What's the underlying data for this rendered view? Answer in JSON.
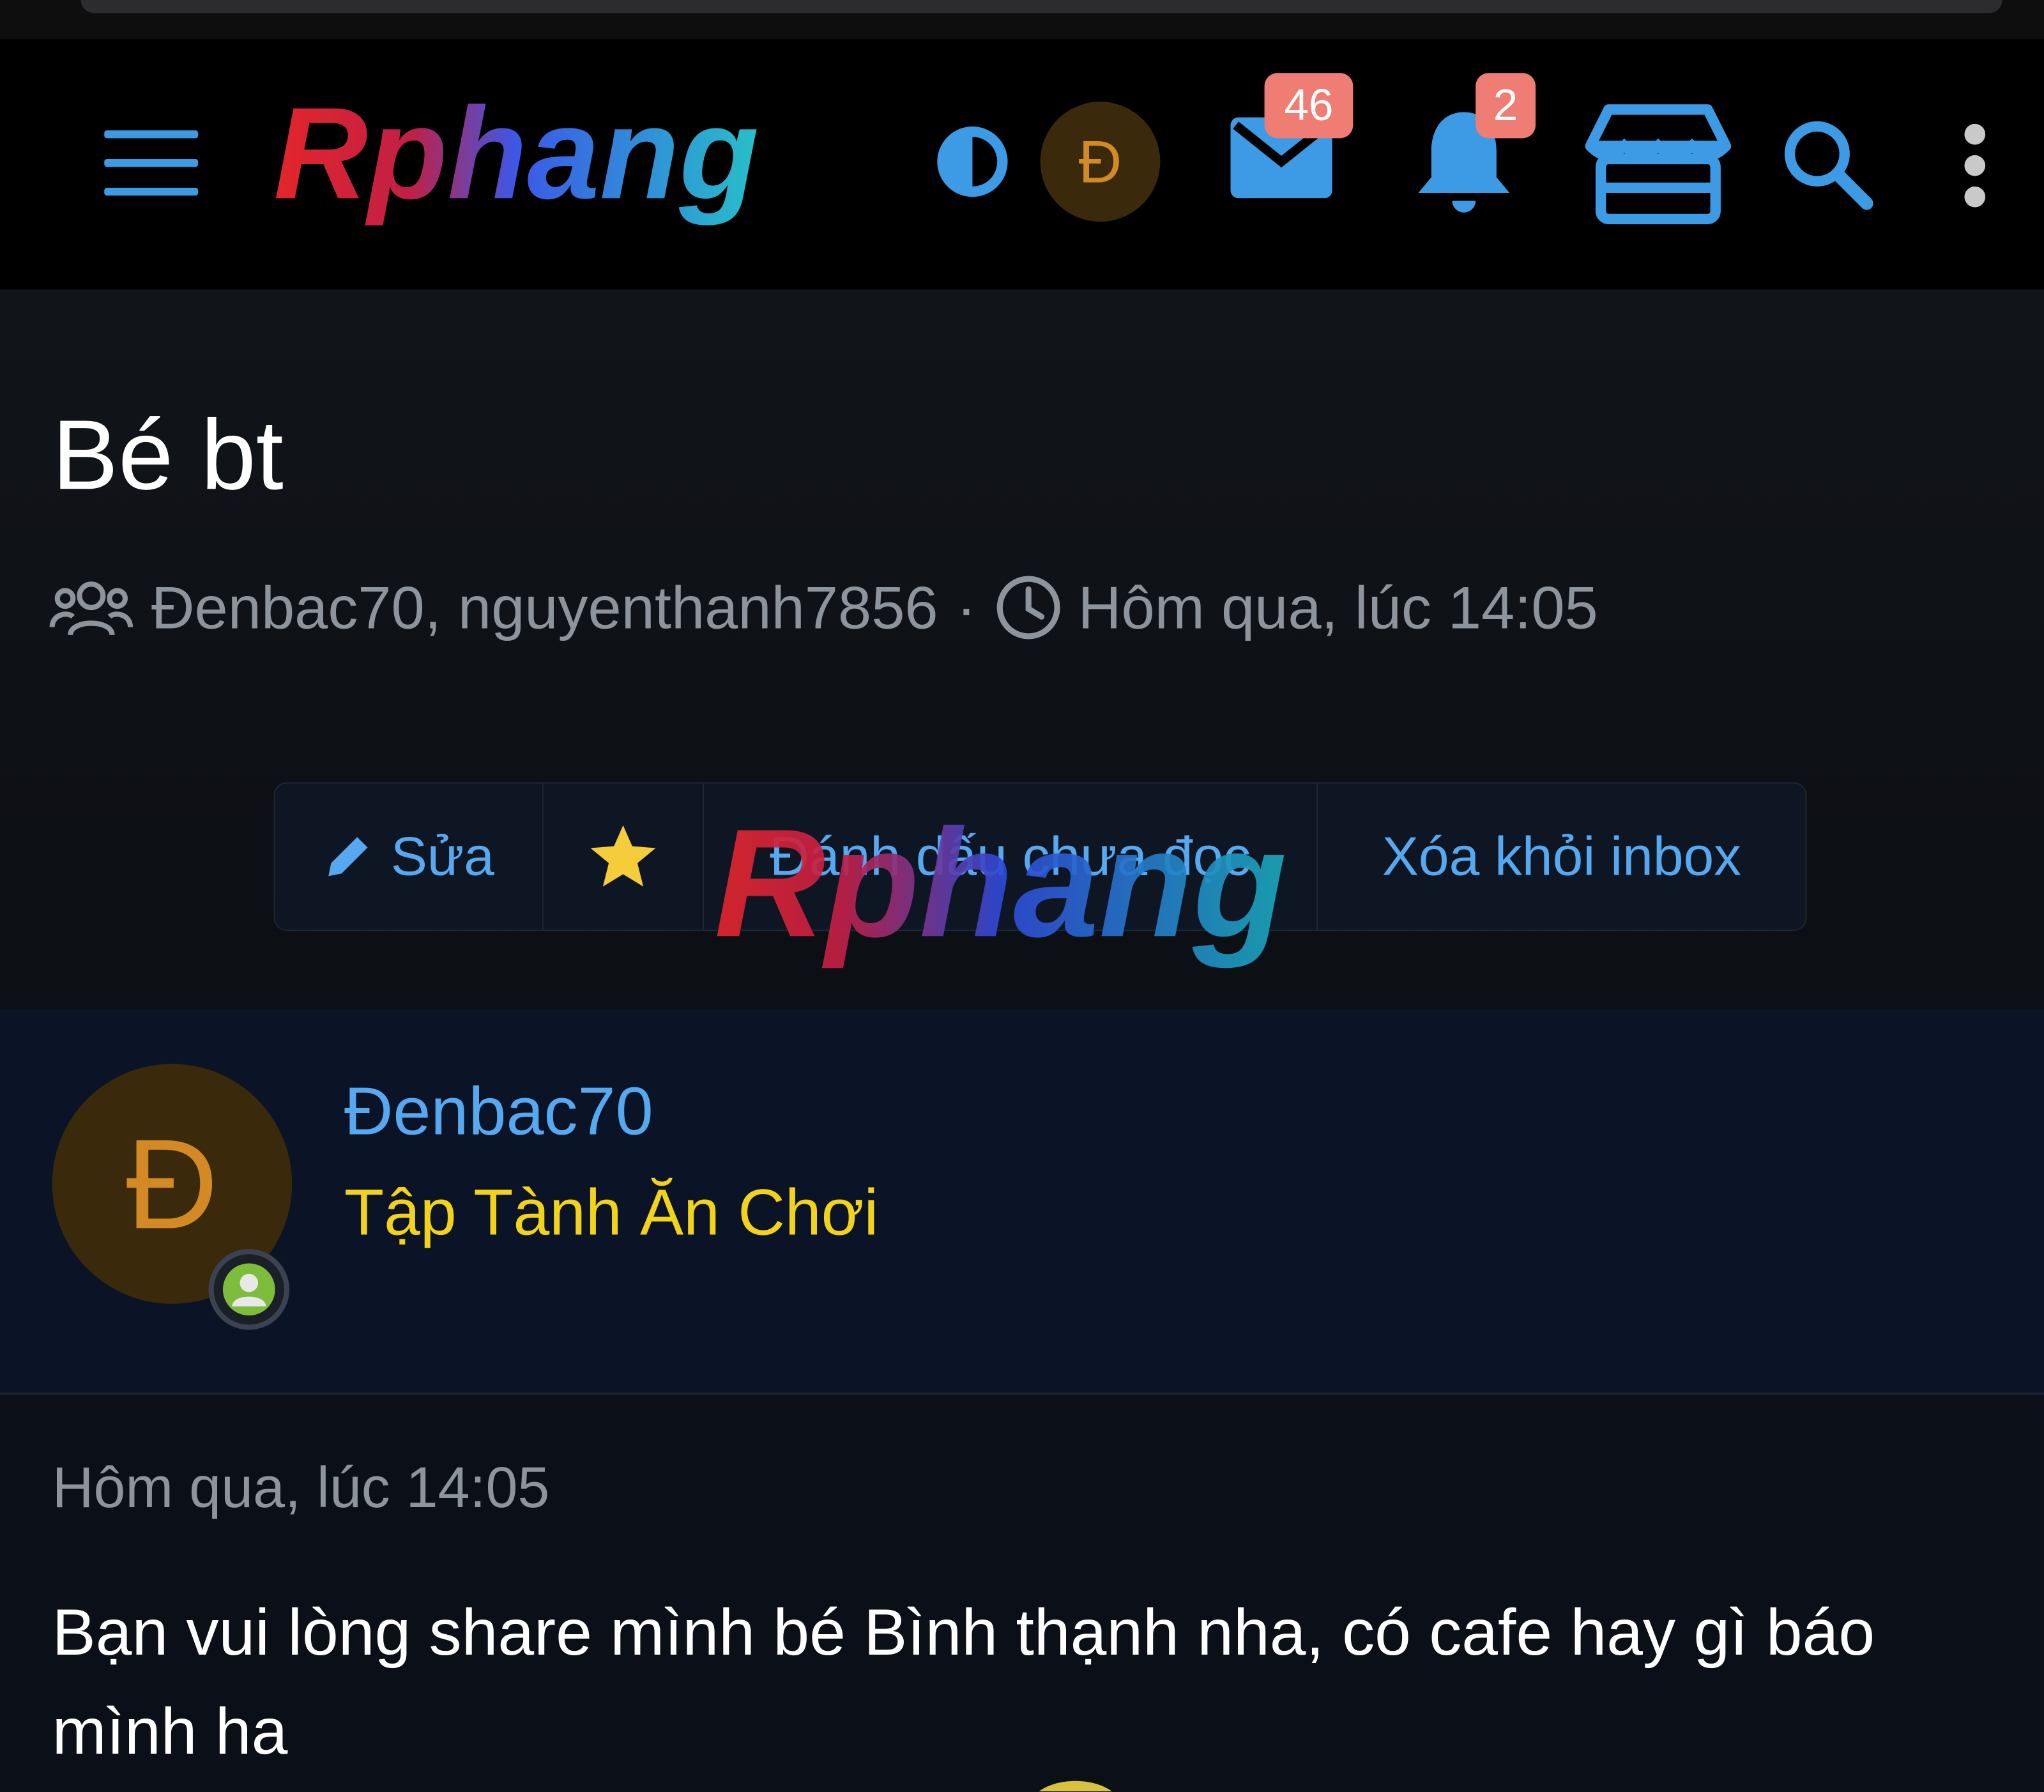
{
  "brand": {
    "logo_text": "Rphang",
    "logo_colors": [
      "#e3262b",
      "#3b58e8",
      "#27c0c9"
    ],
    "accent": "#56a9f1"
  },
  "header": {
    "user_initial": "Đ",
    "messages_badge": "46",
    "alerts_badge": "2",
    "icons": [
      "menu-icon",
      "theme-toggle-icon",
      "mail-icon",
      "bell-icon",
      "store-icon",
      "search-icon",
      "more-vertical-icon"
    ]
  },
  "conversation": {
    "title": "Bé bt",
    "participants": "Đenbac70, nguyenthanh7856",
    "separator": "·",
    "start_time": "Hôm qua, lúc 14:05"
  },
  "actions": {
    "edit_label": "Sửa",
    "mark_unread_label": "Đánh dấu chưa đọc",
    "remove_label": "Xóa khỏi inbox"
  },
  "message": {
    "author_initial": "Đ",
    "author": "Đenbac70",
    "author_title": "Tập Tành Ăn Chơi",
    "time": "Hôm qua, lúc 14:05",
    "text": "Bạn vui lòng share mình bé Bình thạnh nha, có cafe hay gì báo mình ha"
  }
}
